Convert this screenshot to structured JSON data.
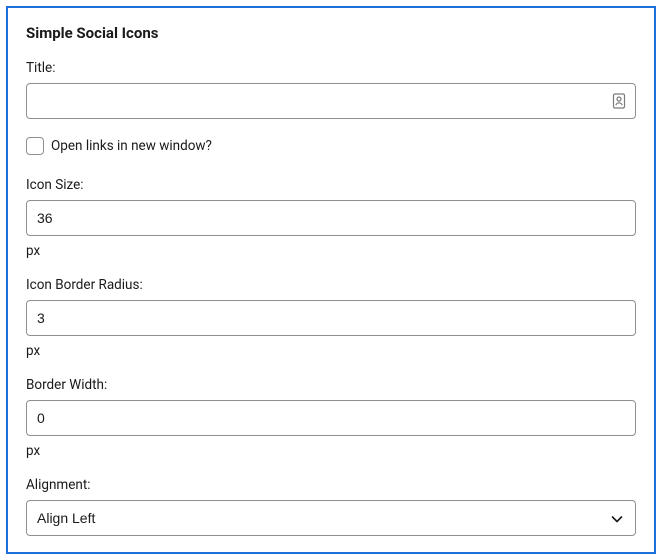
{
  "widget": {
    "title": "Simple Social Icons"
  },
  "fields": {
    "title": {
      "label": "Title:",
      "value": ""
    },
    "new_window": {
      "label": "Open links in new window?",
      "checked": false
    },
    "icon_size": {
      "label": "Icon Size:",
      "value": "36",
      "unit": "px"
    },
    "border_radius": {
      "label": "Icon Border Radius:",
      "value": "3",
      "unit": "px"
    },
    "border_width": {
      "label": "Border Width:",
      "value": "0",
      "unit": "px"
    },
    "alignment": {
      "label": "Alignment:",
      "selected": "Align Left"
    }
  }
}
